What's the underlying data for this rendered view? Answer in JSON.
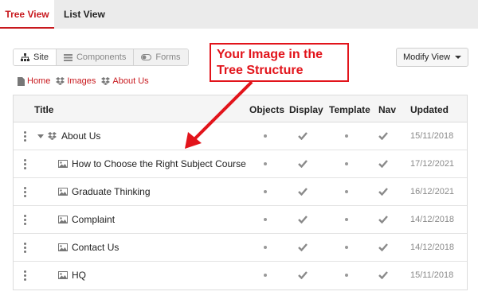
{
  "tabs": [
    {
      "label": "Tree View",
      "active": true
    },
    {
      "label": "List View",
      "active": false
    }
  ],
  "view_switch": [
    {
      "label": "Site",
      "icon": "sitemap-icon",
      "active": true
    },
    {
      "label": "Components",
      "icon": "list-icon",
      "active": false
    },
    {
      "label": "Forms",
      "icon": "toggle-icon",
      "active": false
    }
  ],
  "modify_view": {
    "label": "Modify View"
  },
  "breadcrumb": [
    {
      "label": "Home",
      "icon": "page-icon"
    },
    {
      "label": "Images",
      "icon": "dropbox-icon"
    },
    {
      "label": "About Us",
      "icon": "dropbox-icon"
    }
  ],
  "table": {
    "headers": {
      "title": "Title",
      "objects": "Objects",
      "display": "Display",
      "template": "Template",
      "nav": "Nav",
      "updated": "Updated"
    },
    "rows": [
      {
        "title": "About Us",
        "icon": "dropbox-icon",
        "expandable": true,
        "objects": "dot",
        "display": "check",
        "template": "dot",
        "nav": "check",
        "updated": "15/11/2018"
      },
      {
        "title": "How to Choose the Right Subject Course",
        "icon": "image-icon",
        "expandable": false,
        "objects": "dot",
        "display": "check",
        "template": "dot",
        "nav": "check",
        "updated": "17/12/2021"
      },
      {
        "title": "Graduate Thinking",
        "icon": "image-icon",
        "expandable": false,
        "objects": "dot",
        "display": "check",
        "template": "dot",
        "nav": "check",
        "updated": "16/12/2021"
      },
      {
        "title": "Complaint",
        "icon": "image-icon",
        "expandable": false,
        "objects": "dot",
        "display": "check",
        "template": "dot",
        "nav": "check",
        "updated": "14/12/2018"
      },
      {
        "title": "Contact Us",
        "icon": "image-icon",
        "expandable": false,
        "objects": "dot",
        "display": "check",
        "template": "dot",
        "nav": "check",
        "updated": "14/12/2018"
      },
      {
        "title": "HQ",
        "icon": "image-icon",
        "expandable": false,
        "objects": "dot",
        "display": "check",
        "template": "dot",
        "nav": "check",
        "updated": "15/11/2018"
      }
    ]
  },
  "annotation": {
    "line1": "Your Image in the",
    "line2": "Tree Structure",
    "color": "#e2141b"
  },
  "colors": {
    "accent": "#c8191e",
    "check": "#8a8a8a"
  }
}
